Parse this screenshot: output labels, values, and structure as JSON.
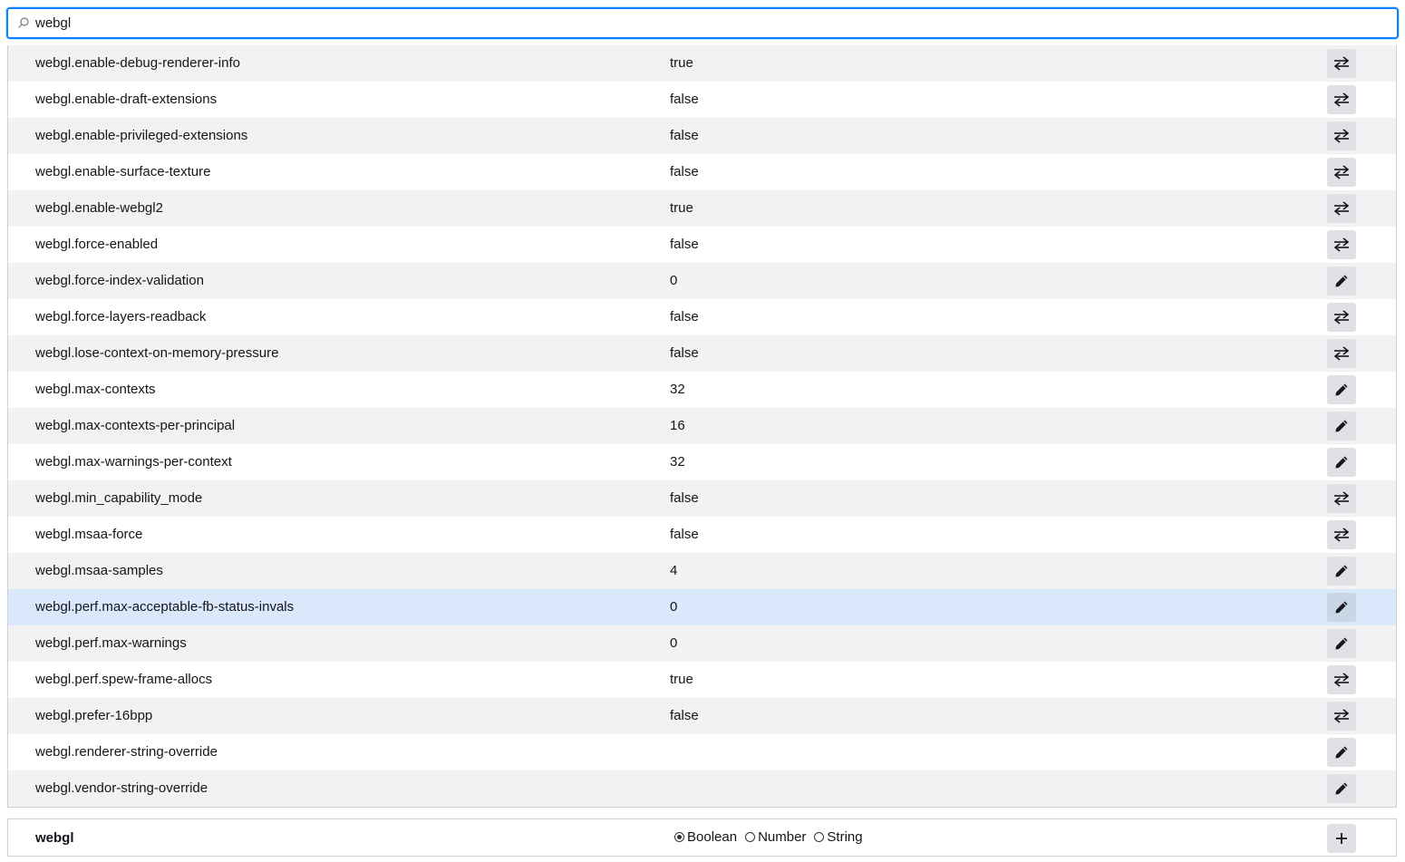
{
  "search": {
    "value": "webgl",
    "icon": "search-icon"
  },
  "prefs": [
    {
      "name": "webgl.enable-debug-renderer-info",
      "value": "true",
      "action": "toggle"
    },
    {
      "name": "webgl.enable-draft-extensions",
      "value": "false",
      "action": "toggle"
    },
    {
      "name": "webgl.enable-privileged-extensions",
      "value": "false",
      "action": "toggle"
    },
    {
      "name": "webgl.enable-surface-texture",
      "value": "false",
      "action": "toggle"
    },
    {
      "name": "webgl.enable-webgl2",
      "value": "true",
      "action": "toggle"
    },
    {
      "name": "webgl.force-enabled",
      "value": "false",
      "action": "toggle"
    },
    {
      "name": "webgl.force-index-validation",
      "value": "0",
      "action": "edit"
    },
    {
      "name": "webgl.force-layers-readback",
      "value": "false",
      "action": "toggle"
    },
    {
      "name": "webgl.lose-context-on-memory-pressure",
      "value": "false",
      "action": "toggle"
    },
    {
      "name": "webgl.max-contexts",
      "value": "32",
      "action": "edit"
    },
    {
      "name": "webgl.max-contexts-per-principal",
      "value": "16",
      "action": "edit"
    },
    {
      "name": "webgl.max-warnings-per-context",
      "value": "32",
      "action": "edit"
    },
    {
      "name": "webgl.min_capability_mode",
      "value": "false",
      "action": "toggle"
    },
    {
      "name": "webgl.msaa-force",
      "value": "false",
      "action": "toggle"
    },
    {
      "name": "webgl.msaa-samples",
      "value": "4",
      "action": "edit"
    },
    {
      "name": "webgl.perf.max-acceptable-fb-status-invals",
      "value": "0",
      "action": "edit",
      "selected": true
    },
    {
      "name": "webgl.perf.max-warnings",
      "value": "0",
      "action": "edit"
    },
    {
      "name": "webgl.perf.spew-frame-allocs",
      "value": "true",
      "action": "toggle"
    },
    {
      "name": "webgl.prefer-16bpp",
      "value": "false",
      "action": "toggle"
    },
    {
      "name": "webgl.renderer-string-override",
      "value": "",
      "action": "edit"
    },
    {
      "name": "webgl.vendor-string-override",
      "value": "",
      "action": "edit"
    }
  ],
  "add_row": {
    "name": "webgl",
    "types": [
      {
        "label": "Boolean",
        "checked": true
      },
      {
        "label": "Number",
        "checked": false
      },
      {
        "label": "String",
        "checked": false
      }
    ],
    "add_icon": "plus-icon"
  },
  "colors": {
    "accent": "#0a84ff",
    "row_alt": "#f2f2f2",
    "row_selected": "#d9e9fb",
    "button_bg": "#e0e0e6"
  }
}
